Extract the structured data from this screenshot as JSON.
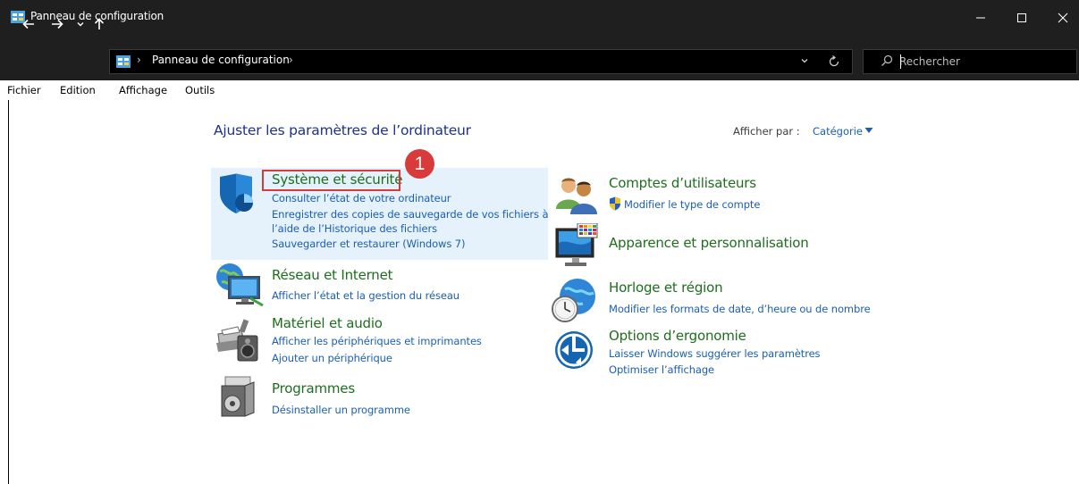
{
  "window": {
    "title": "Panneau de configuration",
    "controls": {
      "minimize": "–",
      "maximize": "☐",
      "close": "✕"
    }
  },
  "address": {
    "breadcrumb": "Panneau de configuration",
    "search_placeholder": "Rechercher"
  },
  "menu": [
    "Fichier",
    "Edition",
    "Affichage",
    "Outils"
  ],
  "main": {
    "title": "Ajuster les paramètres de l’ordinateur",
    "view_by_label": "Afficher par :",
    "view_by_value": "Catégorie",
    "badge_number": "1",
    "categories": [
      {
        "title": "Système et sécurité",
        "icon": "shield-icon",
        "links": [
          "Consulter l’état de votre ordinateur",
          "Enregistrer des copies de sauvegarde de vos fichiers à",
          "l’aide de l’Historique des fichiers",
          "Sauvegarder et restaurer (Windows 7)"
        ]
      },
      {
        "title": "Réseau et Internet",
        "icon": "network-globe-icon",
        "links": [
          "Afficher l’état et la gestion du réseau"
        ]
      },
      {
        "title": "Matériel et audio",
        "icon": "printer-speaker-icon",
        "links": [
          "Afficher les périphériques et imprimantes",
          "Ajouter un périphérique"
        ]
      },
      {
        "title": "Programmes",
        "icon": "programs-box-icon",
        "links": [
          "Désinstaller un programme"
        ]
      },
      {
        "title": "Comptes d’utilisateurs",
        "icon": "users-icon",
        "links": [
          "Modifier le type de compte"
        ]
      },
      {
        "title": "Apparence et personnalisation",
        "icon": "monitor-palette-icon",
        "links": []
      },
      {
        "title": "Horloge et région",
        "icon": "clock-globe-icon",
        "links": [
          "Modifier les formats de date, d’heure ou de nombre"
        ]
      },
      {
        "title": "Options d’ergonomie",
        "icon": "ease-of-access-icon",
        "links": [
          "Laisser Windows suggérer les paramètres",
          "Optimiser l’affichage"
        ]
      }
    ]
  },
  "colors": {
    "title_bar": "#1f1f1f",
    "category_title": "#1d6e1d",
    "link": "#1a5fb4",
    "highlight": "#e5f1fb",
    "annotation_red": "#d63b3b"
  }
}
